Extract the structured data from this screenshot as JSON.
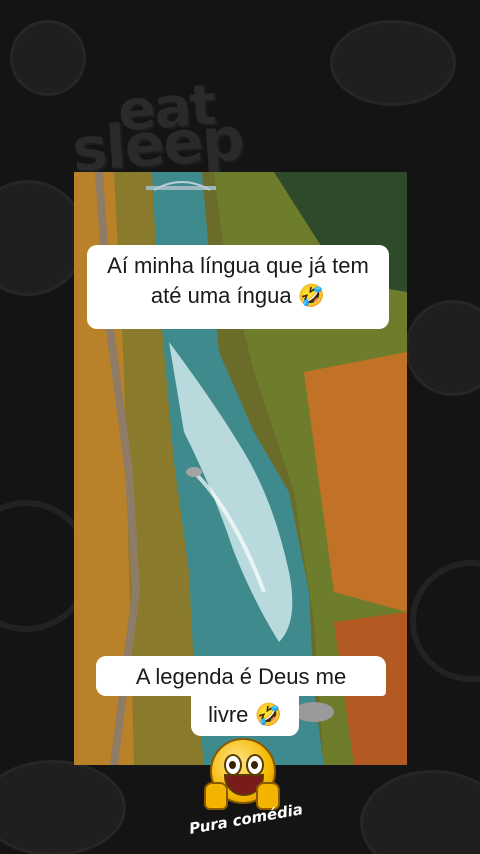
{
  "background": {
    "sticker_words": [
      "eat",
      "sleep"
    ],
    "color": "#141414"
  },
  "video": {
    "description_icon": "river-aerial-video",
    "colors": {
      "water": "#3f8a8c",
      "foam": "#d9eef0",
      "forest_orange": "#c8731f",
      "forest_green": "#5f7a2a"
    }
  },
  "captions": {
    "top": "Aí minha língua que já tem até uma íngua 🤣",
    "bottom_line1": "A legenda é Deus me",
    "bottom_line2": "livre 🤣"
  },
  "brand": {
    "name": "Pura comédia",
    "icon": "thumbs-up-laughing-emoji-icon"
  }
}
